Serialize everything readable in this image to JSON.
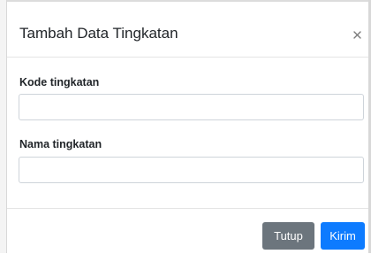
{
  "modal": {
    "title": "Tambah Data Tingkatan",
    "close_glyph": "×",
    "close_icon": "close-icon"
  },
  "form": {
    "kode_label": "Kode tingkatan",
    "kode_value": "",
    "kode_placeholder": "",
    "nama_label": "Nama tingkatan",
    "nama_value": "",
    "nama_placeholder": ""
  },
  "footer": {
    "tutup_label": "Tutup",
    "kirim_label": "Kirim"
  },
  "colors": {
    "secondary_button": "#6c757d",
    "primary_button": "#0d7bff",
    "text": "#212529",
    "input_border": "#ced4da"
  }
}
